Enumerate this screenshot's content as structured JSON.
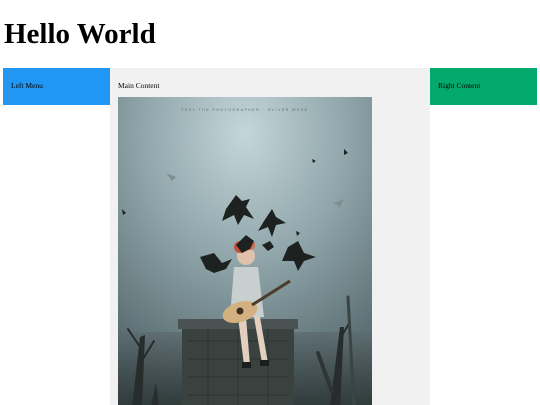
{
  "header": {
    "title": "Hello World"
  },
  "columns": {
    "left": {
      "label": "Left Menu",
      "color": "#2196f3"
    },
    "main": {
      "label": "Main Content",
      "color": "#f1f1f1"
    },
    "right": {
      "label": "Right Content",
      "color": "#04aa6d"
    }
  },
  "image": {
    "subject": "girl playing guitar surrounded by crows",
    "caption": "FEEL THE PHOTOGRAPHER · OLIVER WEKE"
  }
}
